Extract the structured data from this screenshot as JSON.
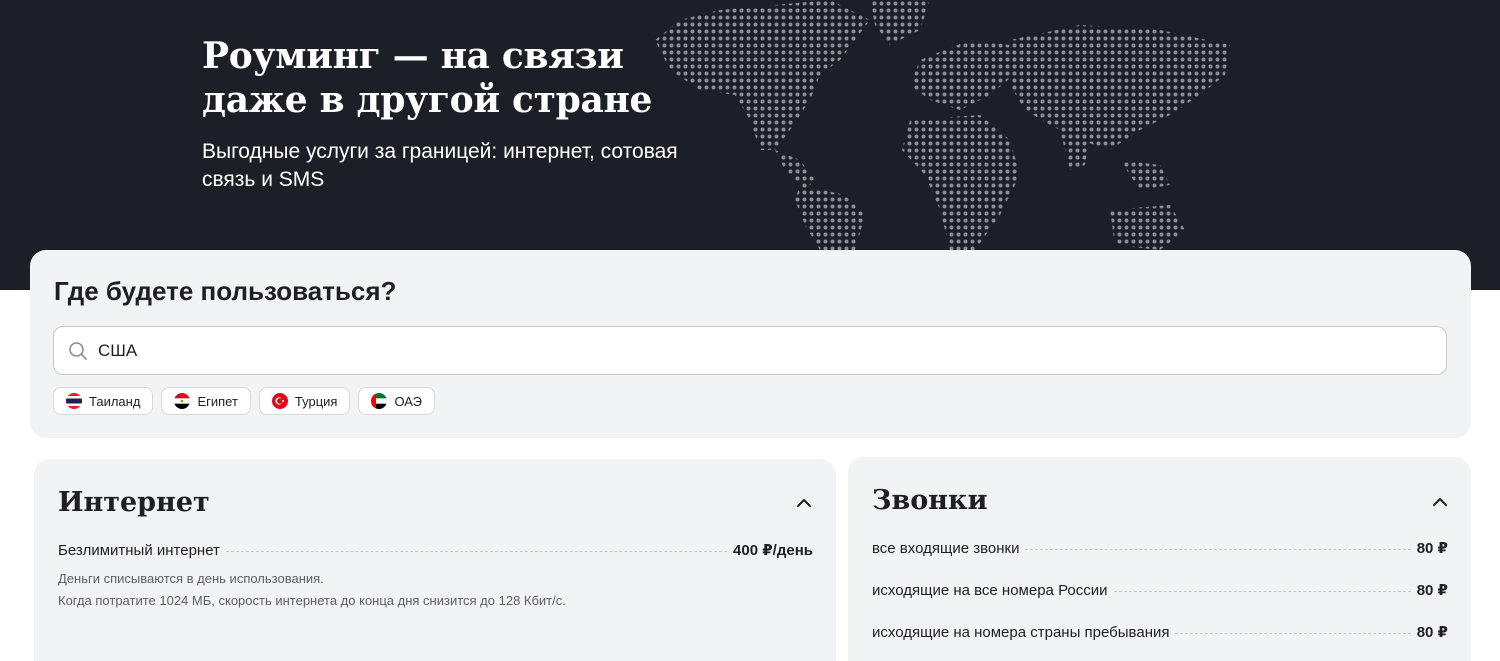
{
  "hero": {
    "title": "Роуминг — на связи даже в другой стране",
    "subtitle": "Выгодные услуги за границей: интернет, сотовая связь и SMS"
  },
  "search": {
    "heading": "Где будете пользоваться?",
    "value": "США",
    "chips": [
      {
        "label": "Таиланд",
        "icon": "thailand-flag-icon"
      },
      {
        "label": "Египет",
        "icon": "egypt-flag-icon"
      },
      {
        "label": "Турция",
        "icon": "turkey-flag-icon"
      },
      {
        "label": "ОАЭ",
        "icon": "uae-flag-icon"
      }
    ]
  },
  "internet": {
    "title": "Интернет",
    "rows": [
      {
        "label": "Безлимитный интернет",
        "price": "400 ₽/день"
      }
    ],
    "notes": [
      "Деньги списываются в день использования.",
      "Когда потратите 1024 МБ, скорость интернета до конца дня снизится до 128 Кбит/с."
    ]
  },
  "calls": {
    "title": "Звонки",
    "rows": [
      {
        "label": "все входящие звонки",
        "price": "80 ₽"
      },
      {
        "label": "исходящие на все номера России",
        "price": "80 ₽"
      },
      {
        "label": "исходящие на номера страны пребывания",
        "price": "80 ₽"
      }
    ]
  },
  "colors": {
    "hero_bg": "#1d1f26",
    "card_bg": "#f2f3f5",
    "text": "#1d1f25",
    "muted": "#5b5f67"
  }
}
